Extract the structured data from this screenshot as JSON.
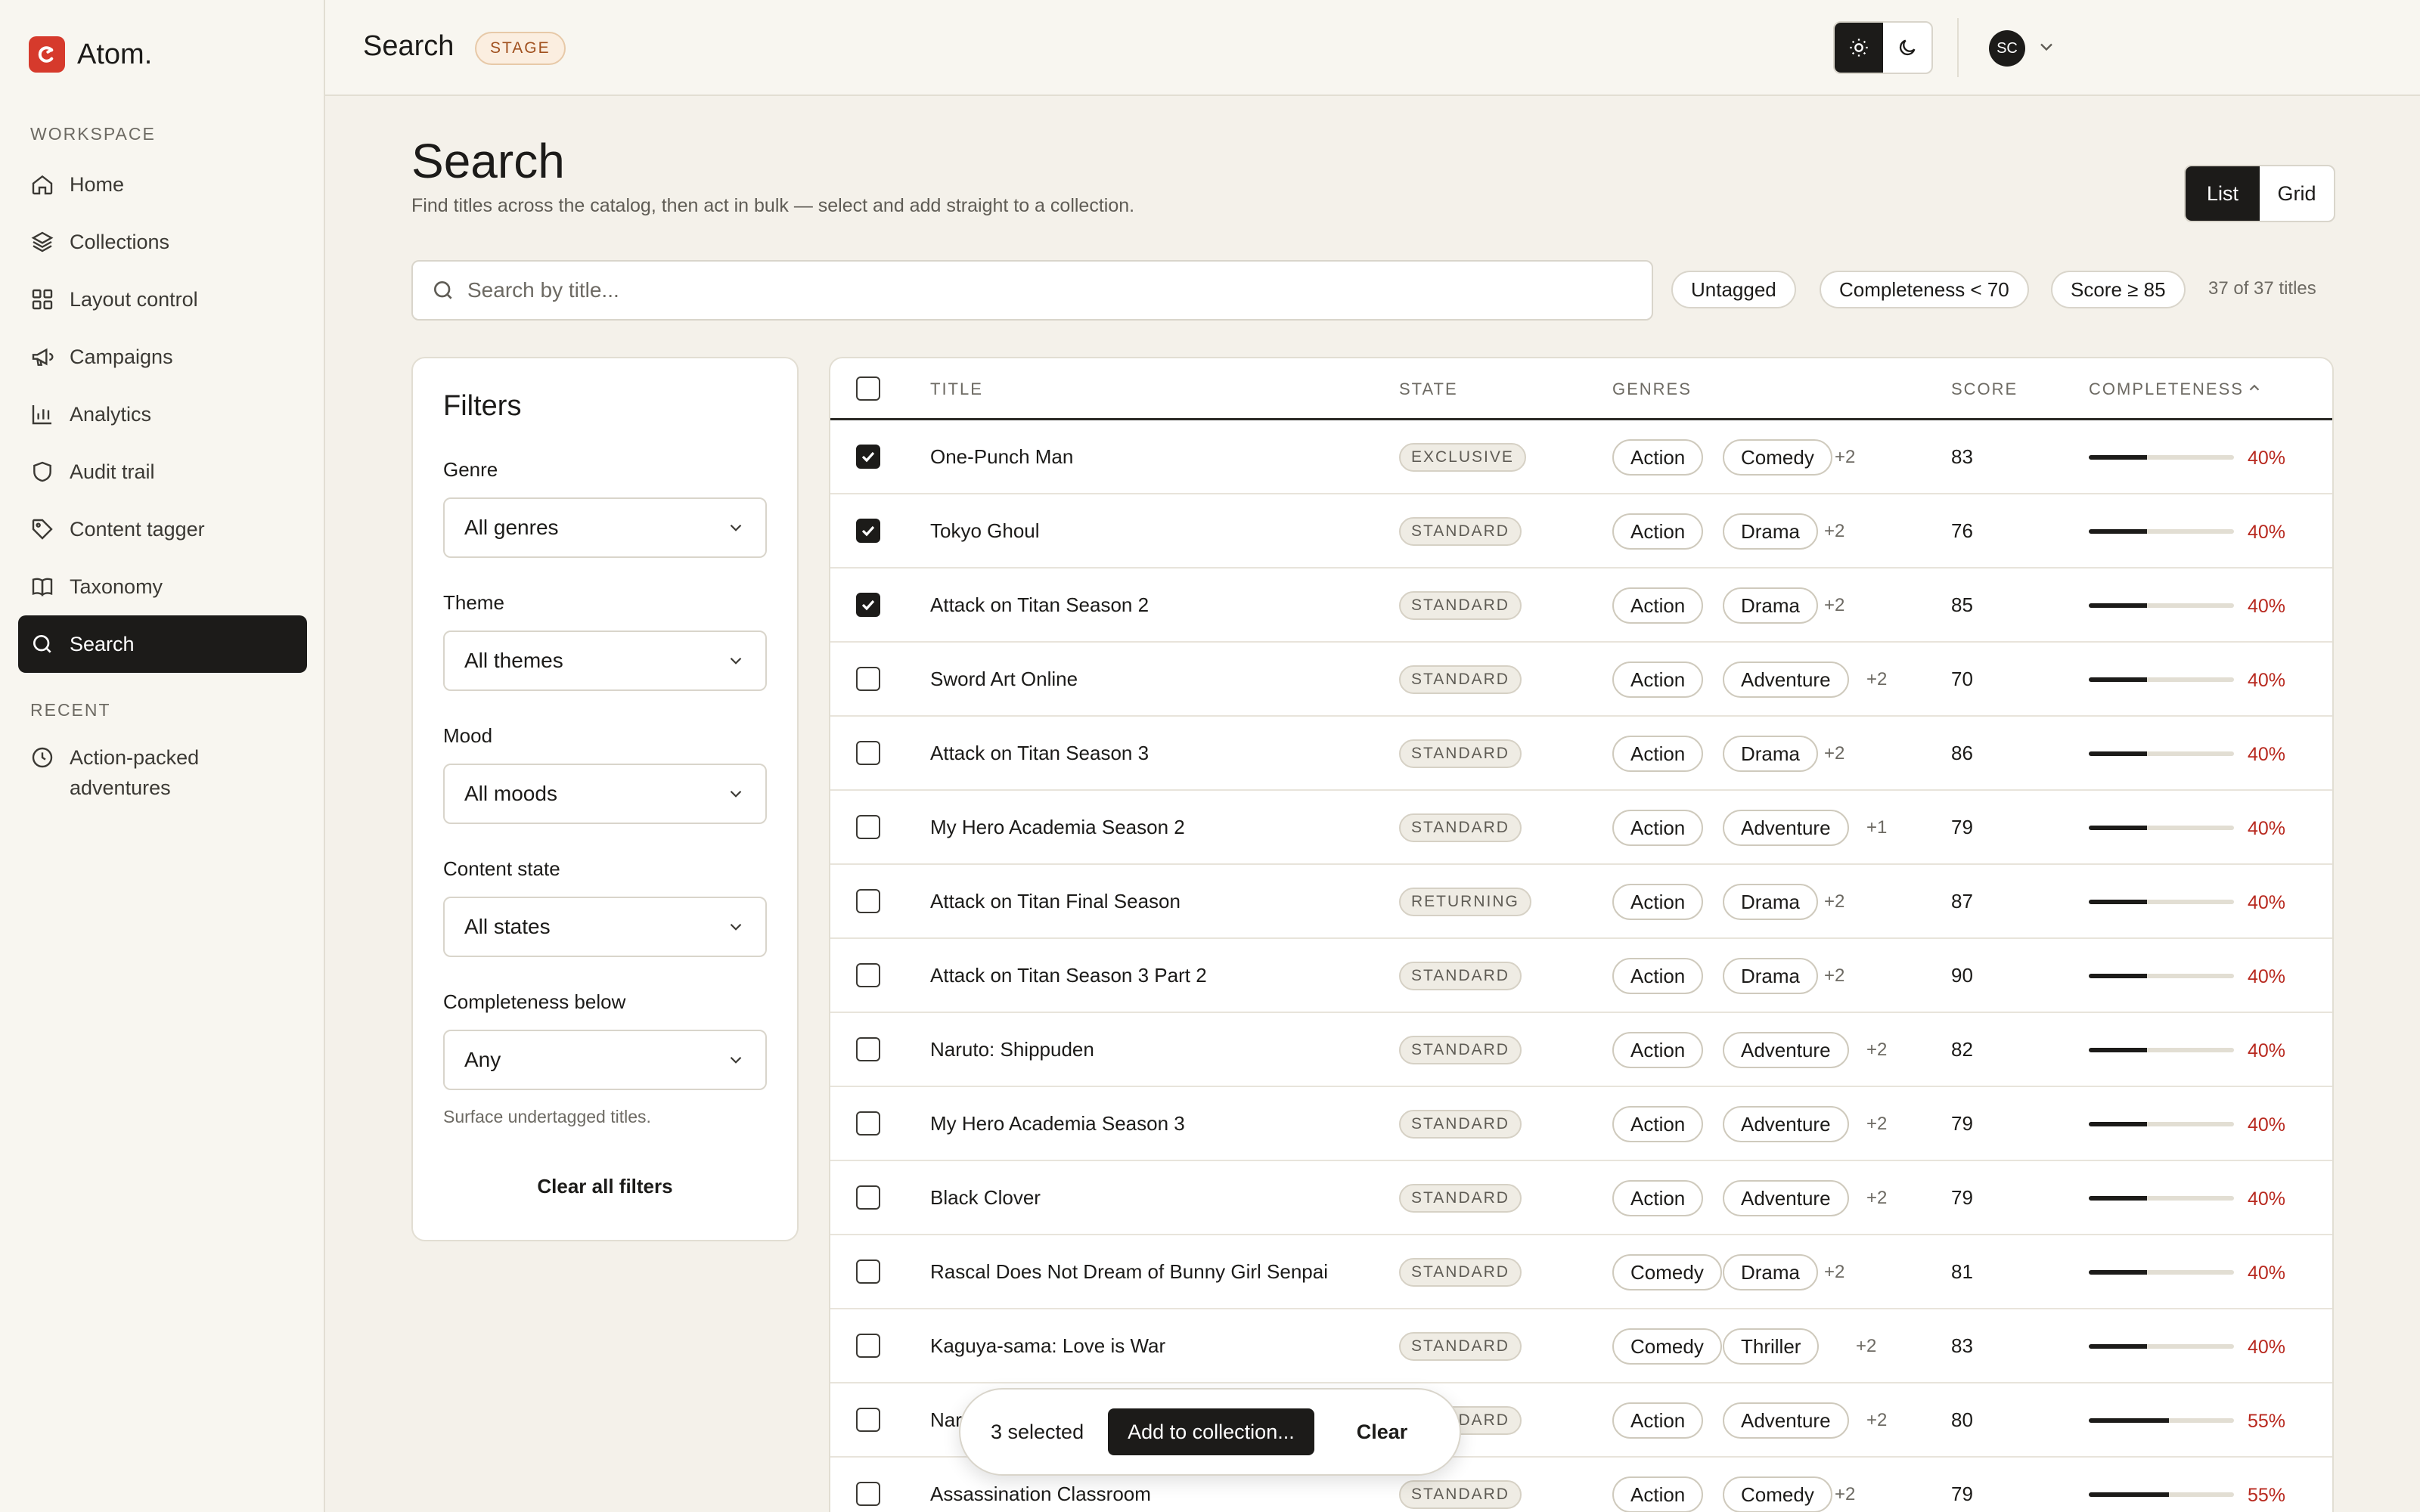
{
  "app": {
    "name": "Atom."
  },
  "sidebar": {
    "workspace_label": "WORKSPACE",
    "items": [
      {
        "label": "Home",
        "icon": "home-icon"
      },
      {
        "label": "Collections",
        "icon": "layers-icon"
      },
      {
        "label": "Layout control",
        "icon": "grid-icon"
      },
      {
        "label": "Campaigns",
        "icon": "megaphone-icon"
      },
      {
        "label": "Analytics",
        "icon": "bar-chart-icon"
      },
      {
        "label": "Audit trail",
        "icon": "shield-icon"
      },
      {
        "label": "Content tagger",
        "icon": "tag-icon"
      },
      {
        "label": "Taxonomy",
        "icon": "book-icon"
      },
      {
        "label": "Search",
        "icon": "search-icon",
        "active": true
      }
    ],
    "recent_label": "RECENT",
    "recent": [
      {
        "label": "Action-packed adventures",
        "icon": "clock-icon"
      }
    ]
  },
  "topbar": {
    "title": "Search",
    "badge": "STAGE",
    "avatar_initials": "SC"
  },
  "page": {
    "title": "Search",
    "subtitle": "Find titles across the catalog, then act in bulk — select and add straight to a collection.",
    "view_options": [
      "List",
      "Grid"
    ],
    "view_selected": "List"
  },
  "search": {
    "placeholder": "Search by title..."
  },
  "chips": [
    "Untagged",
    "Completeness < 70",
    "Score ≥ 85"
  ],
  "result_count": "37 of 37 titles",
  "filters": {
    "title": "Filters",
    "fields": [
      {
        "label": "Genre",
        "value": "All genres"
      },
      {
        "label": "Theme",
        "value": "All themes"
      },
      {
        "label": "Mood",
        "value": "All moods"
      },
      {
        "label": "Content state",
        "value": "All states"
      },
      {
        "label": "Completeness below",
        "value": "Any"
      }
    ],
    "hint": "Surface undertagged titles.",
    "clear_label": "Clear all filters"
  },
  "table": {
    "columns": {
      "title": "TITLE",
      "state": "STATE",
      "genres": "GENRES",
      "score": "SCORE",
      "completeness": "COMPLETENESS"
    },
    "sort_indicator": "chevron-up-icon",
    "rows": [
      {
        "checked": true,
        "title": "One-Punch Man",
        "state": "EXCLUSIVE",
        "genres": [
          "Action",
          "Comedy"
        ],
        "more": "+2",
        "score": "83",
        "completeness": 0.4,
        "completeness_label": "40%"
      },
      {
        "checked": true,
        "title": "Tokyo Ghoul",
        "state": "STANDARD",
        "genres": [
          "Action",
          "Drama"
        ],
        "more": "+2",
        "score": "76",
        "completeness": 0.4,
        "completeness_label": "40%"
      },
      {
        "checked": true,
        "title": "Attack on Titan Season 2",
        "state": "STANDARD",
        "genres": [
          "Action",
          "Drama"
        ],
        "more": "+2",
        "score": "85",
        "completeness": 0.4,
        "completeness_label": "40%"
      },
      {
        "checked": false,
        "title": "Sword Art Online",
        "state": "STANDARD",
        "genres": [
          "Action",
          "Adventure"
        ],
        "more": "+2",
        "score": "70",
        "completeness": 0.4,
        "completeness_label": "40%"
      },
      {
        "checked": false,
        "title": "Attack on Titan Season 3",
        "state": "STANDARD",
        "genres": [
          "Action",
          "Drama"
        ],
        "more": "+2",
        "score": "86",
        "completeness": 0.4,
        "completeness_label": "40%"
      },
      {
        "checked": false,
        "title": "My Hero Academia Season 2",
        "state": "STANDARD",
        "genres": [
          "Action",
          "Adventure"
        ],
        "more": "+1",
        "score": "79",
        "completeness": 0.4,
        "completeness_label": "40%"
      },
      {
        "checked": false,
        "title": "Attack on Titan Final Season",
        "state": "RETURNING",
        "genres": [
          "Action",
          "Drama"
        ],
        "more": "+2",
        "score": "87",
        "completeness": 0.4,
        "completeness_label": "40%"
      },
      {
        "checked": false,
        "title": "Attack on Titan Season 3 Part 2",
        "state": "STANDARD",
        "genres": [
          "Action",
          "Drama"
        ],
        "more": "+2",
        "score": "90",
        "completeness": 0.4,
        "completeness_label": "40%"
      },
      {
        "checked": false,
        "title": "Naruto: Shippuden",
        "state": "STANDARD",
        "genres": [
          "Action",
          "Adventure"
        ],
        "more": "+2",
        "score": "82",
        "completeness": 0.4,
        "completeness_label": "40%"
      },
      {
        "checked": false,
        "title": "My Hero Academia Season 3",
        "state": "STANDARD",
        "genres": [
          "Action",
          "Adventure"
        ],
        "more": "+2",
        "score": "79",
        "completeness": 0.4,
        "completeness_label": "40%"
      },
      {
        "checked": false,
        "title": "Black Clover",
        "state": "STANDARD",
        "genres": [
          "Action",
          "Adventure"
        ],
        "more": "+2",
        "score": "79",
        "completeness": 0.4,
        "completeness_label": "40%"
      },
      {
        "checked": false,
        "title": "Rascal Does Not Dream of Bunny Girl Senpai",
        "state": "STANDARD",
        "genres": [
          "Comedy",
          "Drama"
        ],
        "more": "+2",
        "score": "81",
        "completeness": 0.4,
        "completeness_label": "40%"
      },
      {
        "checked": false,
        "title": "Kaguya-sama: Love is War",
        "state": "STANDARD",
        "genres": [
          "Comedy",
          "Thriller"
        ],
        "more": "+2",
        "score": "83",
        "completeness": 0.4,
        "completeness_label": "40%"
      },
      {
        "checked": false,
        "title": "Nar",
        "state": "STANDARD",
        "genres": [
          "Action",
          "Adventure"
        ],
        "more": "+2",
        "score": "80",
        "completeness": 0.55,
        "completeness_label": "55%"
      },
      {
        "checked": false,
        "title": "Assassination Classroom",
        "state": "STANDARD",
        "genres": [
          "Action",
          "Comedy"
        ],
        "more": "+2",
        "score": "79",
        "completeness": 0.55,
        "completeness_label": "55%"
      }
    ]
  },
  "bulk_bar": {
    "count": "3 selected",
    "add_label": "Add to collection...",
    "clear_label": "Clear"
  },
  "colors": {
    "accent": "#1c1b19",
    "brand": "#d63a2c",
    "warning_text": "#b8291f",
    "background": "#f4f1ea"
  }
}
